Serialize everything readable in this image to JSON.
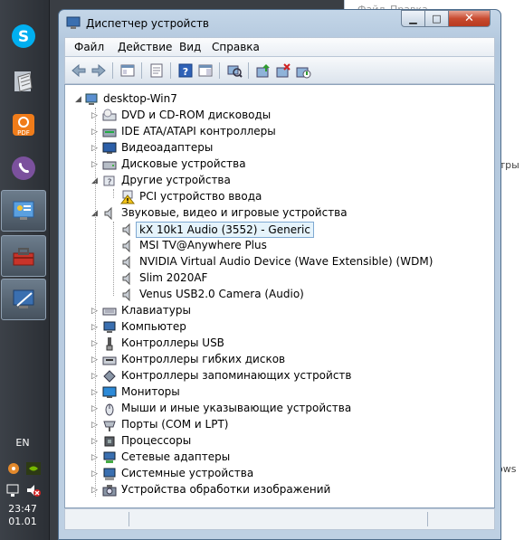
{
  "window": {
    "title": "Диспетчер устройств"
  },
  "menu": [
    "Файл",
    "Действие",
    "Вид",
    "Справка"
  ],
  "tree": {
    "root": "desktop-Win7",
    "nodes": [
      {
        "label": "DVD и CD-ROM дисководы",
        "icon": "dvd-drive-icon",
        "expanded": false
      },
      {
        "label": "IDE ATA/ATAPI контроллеры",
        "icon": "ide-controller-icon",
        "expanded": false
      },
      {
        "label": "Видеоадаптеры",
        "icon": "display-adapter-icon",
        "expanded": false
      },
      {
        "label": "Дисковые устройства",
        "icon": "disk-drive-icon",
        "expanded": false
      },
      {
        "label": "Другие устройства",
        "icon": "other-devices-icon",
        "expanded": true,
        "children": [
          {
            "label": "PCI устройство ввода",
            "icon": "warning-device-icon"
          }
        ]
      },
      {
        "label": "Звуковые, видео и игровые устройства",
        "icon": "speaker-icon",
        "expanded": true,
        "children": [
          {
            "label": "kX 10k1 Audio (3552) - Generic",
            "icon": "speaker-icon",
            "selected": true
          },
          {
            "label": "MSI TV@Anywhere Plus",
            "icon": "speaker-icon"
          },
          {
            "label": "NVIDIA Virtual Audio Device (Wave Extensible) (WDM)",
            "icon": "speaker-icon"
          },
          {
            "label": "Slim 2020AF",
            "icon": "speaker-icon"
          },
          {
            "label": "Venus USB2.0 Camera (Audio)",
            "icon": "speaker-icon"
          }
        ]
      },
      {
        "label": "Клавиатуры",
        "icon": "keyboard-icon",
        "expanded": false
      },
      {
        "label": "Компьютер",
        "icon": "computer-icon",
        "expanded": false
      },
      {
        "label": "Контроллеры USB",
        "icon": "usb-icon",
        "expanded": false
      },
      {
        "label": "Контроллеры гибких дисков",
        "icon": "floppy-controller-icon",
        "expanded": false
      },
      {
        "label": "Контроллеры запоминающих устройств",
        "icon": "storage-controller-icon",
        "expanded": false
      },
      {
        "label": "Мониторы",
        "icon": "monitor-icon",
        "expanded": false
      },
      {
        "label": "Мыши и иные указывающие устройства",
        "icon": "mouse-icon",
        "expanded": false
      },
      {
        "label": "Порты (COM и LPT)",
        "icon": "port-icon",
        "expanded": false
      },
      {
        "label": "Процессоры",
        "icon": "processor-icon",
        "expanded": false
      },
      {
        "label": "Сетевые адаптеры",
        "icon": "network-adapter-icon",
        "expanded": false
      },
      {
        "label": "Системные устройства",
        "icon": "system-device-icon",
        "expanded": false
      },
      {
        "label": "Устройства обработки изображений",
        "icon": "imaging-device-icon",
        "expanded": false
      }
    ]
  },
  "taskbar": {
    "language": "EN",
    "time": "23:47",
    "date": "01.01"
  },
  "background_window": {
    "texts": [
      "Файл",
      "Правка",
      "етры",
      "ows"
    ]
  },
  "colors": {
    "accent": "#3399ff",
    "selection_bg": "#e5f3fb",
    "selection_border": "#7fa9d2",
    "close_red": "#c84b30"
  }
}
